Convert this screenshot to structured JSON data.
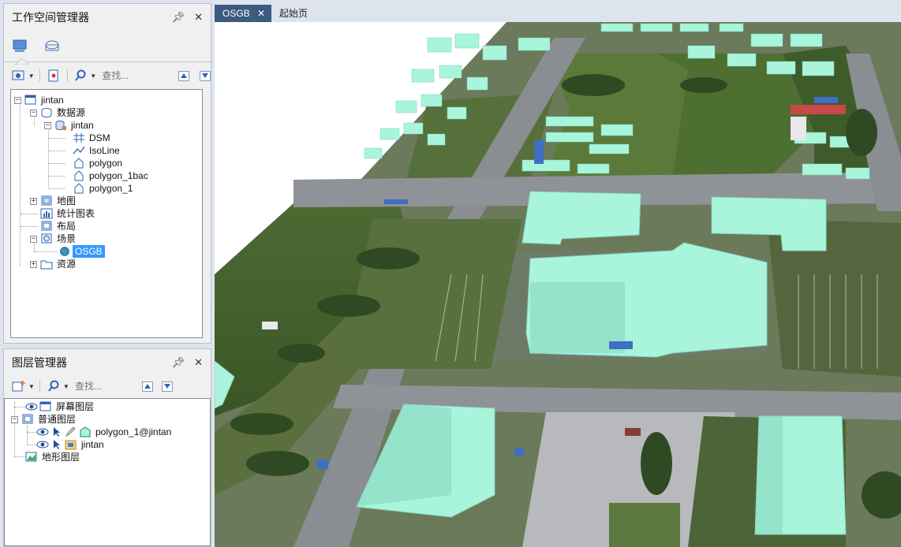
{
  "workspace_panel": {
    "title": "工作空间管理器",
    "pin_icon": "pin-icon",
    "close_icon": "close-icon",
    "search_placeholder": "查找...",
    "tree": {
      "root": "jintan",
      "datasources": "数据源",
      "datasource_name": "jintan",
      "datasets": [
        "DSM",
        "IsoLine",
        "polygon",
        "polygon_1bac",
        "polygon_1"
      ],
      "maps": "地图",
      "charts": "统计图表",
      "layouts": "布局",
      "scenes": "场景",
      "scene_name": "OSGB",
      "resources": "资源"
    }
  },
  "layer_panel": {
    "title": "图层管理器",
    "search_placeholder": "查找...",
    "tree": {
      "screen_layers": "屏幕图层",
      "normal_layers": "普通图层",
      "layer1": "polygon_1@jintan",
      "layer2": "jintan",
      "terrain_layers": "地形图层"
    }
  },
  "doc_tabs": {
    "active": "OSGB",
    "close": "✕",
    "start": "起始页"
  },
  "colors": {
    "building": "#a8f5dc",
    "active_tab": "#3d5a80",
    "selection": "#3399ff"
  }
}
